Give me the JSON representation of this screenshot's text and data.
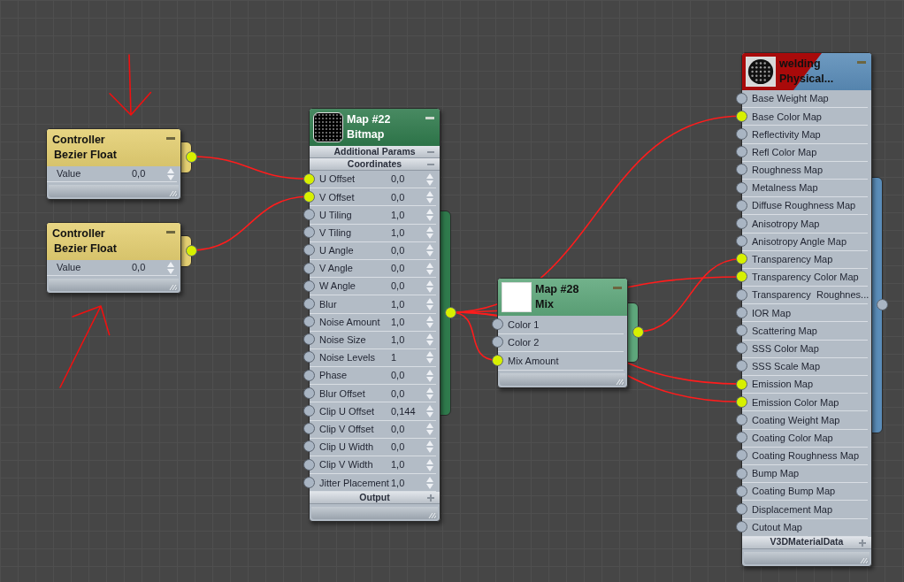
{
  "nodes": [
    {
      "kind": "controller",
      "title": "Controller",
      "subtitle": "Bezier Float",
      "color": "#e4cf72",
      "output_connected": true,
      "sections": [
        {
          "kind": "param",
          "label": "Value",
          "value": "0,0"
        }
      ]
    },
    {
      "kind": "controller",
      "title": "Controller",
      "subtitle": "Bezier Float",
      "color": "#e4cf72",
      "output_connected": true,
      "sections": [
        {
          "kind": "param",
          "label": "Value",
          "value": "0,0"
        }
      ]
    },
    {
      "kind": "map",
      "title": "Map #22",
      "subtitle": "Bitmap",
      "color": "#2f7a4c",
      "thumbnail": {
        "kind": "texture"
      },
      "output_connected": true,
      "sections": [
        {
          "kind": "rollout",
          "label": "Additional Params",
          "expanded": true
        },
        {
          "kind": "rollout",
          "label": "Coordinates",
          "expanded": true
        },
        {
          "kind": "param",
          "label": "U Offset",
          "value": "0,0",
          "connected": true
        },
        {
          "kind": "param",
          "label": "V Offset",
          "value": "0,0",
          "connected": true
        },
        {
          "kind": "param",
          "label": "U Tiling",
          "value": "1,0",
          "connected": false
        },
        {
          "kind": "param",
          "label": "V Tiling",
          "value": "1,0",
          "connected": false
        },
        {
          "kind": "param",
          "label": "U Angle",
          "value": "0,0",
          "connected": false
        },
        {
          "kind": "param",
          "label": "V Angle",
          "value": "0,0",
          "connected": false
        },
        {
          "kind": "param",
          "label": "W Angle",
          "value": "0,0",
          "connected": false
        },
        {
          "kind": "param",
          "label": "Blur",
          "value": "1,0",
          "connected": false
        },
        {
          "kind": "param",
          "label": "Noise Amount",
          "value": "1,0",
          "connected": false
        },
        {
          "kind": "param",
          "label": "Noise Size",
          "value": "1,0",
          "connected": false
        },
        {
          "kind": "param",
          "label": "Noise Levels",
          "value": "1",
          "connected": false
        },
        {
          "kind": "param",
          "label": "Phase",
          "value": "0,0",
          "connected": false
        },
        {
          "kind": "param",
          "label": "Blur Offset",
          "value": "0,0",
          "connected": false
        },
        {
          "kind": "param",
          "label": "Clip U Offset",
          "value": "0,144",
          "connected": false
        },
        {
          "kind": "param",
          "label": "Clip V Offset",
          "value": "0,0",
          "connected": false
        },
        {
          "kind": "param",
          "label": "Clip U Width",
          "value": "0,0",
          "connected": false
        },
        {
          "kind": "param",
          "label": "Clip V Width",
          "value": "1,0",
          "connected": false
        },
        {
          "kind": "param",
          "label": "Jitter Placement",
          "value": "1,0",
          "connected": false
        },
        {
          "kind": "rollout",
          "label": "Output",
          "expanded": false
        }
      ]
    },
    {
      "kind": "map",
      "title": "Map #28",
      "subtitle": "Mix",
      "color": "#5ea77b",
      "thumbnail": {
        "kind": "blank"
      },
      "output_connected": true,
      "sections": [
        {
          "kind": "param",
          "label": "Color 1",
          "connected": false
        },
        {
          "kind": "param",
          "label": "Color 2",
          "connected": false
        },
        {
          "kind": "param",
          "label": "Mix Amount",
          "connected": true
        }
      ]
    },
    {
      "kind": "material",
      "title": "welding",
      "subtitle": "Physical...",
      "color": "#5a8cb8",
      "thumbnail": {
        "kind": "sphere"
      },
      "header_flag": true,
      "output_connected": false,
      "sections": [
        {
          "kind": "param",
          "label": "Base Weight Map",
          "connected": false
        },
        {
          "kind": "param",
          "label": "Base Color Map",
          "connected": true
        },
        {
          "kind": "param",
          "label": "Reflectivity Map",
          "connected": false
        },
        {
          "kind": "param",
          "label": "Refl Color Map",
          "connected": false
        },
        {
          "kind": "param",
          "label": "Roughness Map",
          "connected": false
        },
        {
          "kind": "param",
          "label": "Metalness Map",
          "connected": false
        },
        {
          "kind": "param",
          "label": "Diffuse Roughness Map",
          "connected": false
        },
        {
          "kind": "param",
          "label": "Anisotropy Map",
          "connected": false
        },
        {
          "kind": "param",
          "label": "Anisotropy Angle Map",
          "connected": false
        },
        {
          "kind": "param",
          "label": "Transparency Map",
          "connected": true
        },
        {
          "kind": "param",
          "label": "Transparency Color Map",
          "connected": true
        },
        {
          "kind": "param",
          "label": "Transparency  Roughnes...",
          "connected": false
        },
        {
          "kind": "param",
          "label": "IOR Map",
          "connected": false
        },
        {
          "kind": "param",
          "label": "Scattering Map",
          "connected": false
        },
        {
          "kind": "param",
          "label": "SSS Color Map",
          "connected": false
        },
        {
          "kind": "param",
          "label": "SSS Scale Map",
          "connected": false
        },
        {
          "kind": "param",
          "label": "Emission Map",
          "connected": true
        },
        {
          "kind": "param",
          "label": "Emission Color Map",
          "connected": true
        },
        {
          "kind": "param",
          "label": "Coating Weight Map",
          "connected": false
        },
        {
          "kind": "param",
          "label": "Coating Color Map",
          "connected": false
        },
        {
          "kind": "param",
          "label": "Coating Roughness Map",
          "connected": false
        },
        {
          "kind": "param",
          "label": "Bump Map",
          "connected": false
        },
        {
          "kind": "param",
          "label": "Coating Bump Map",
          "connected": false
        },
        {
          "kind": "param",
          "label": "Displacement Map",
          "connected": false
        },
        {
          "kind": "param",
          "label": "Cutout Map",
          "connected": false
        },
        {
          "kind": "rollout",
          "label": "V3DMaterialData",
          "expanded": false
        }
      ]
    }
  ],
  "annotations": [
    {
      "kind": "down-arrow"
    },
    {
      "kind": "up-arrow"
    }
  ]
}
